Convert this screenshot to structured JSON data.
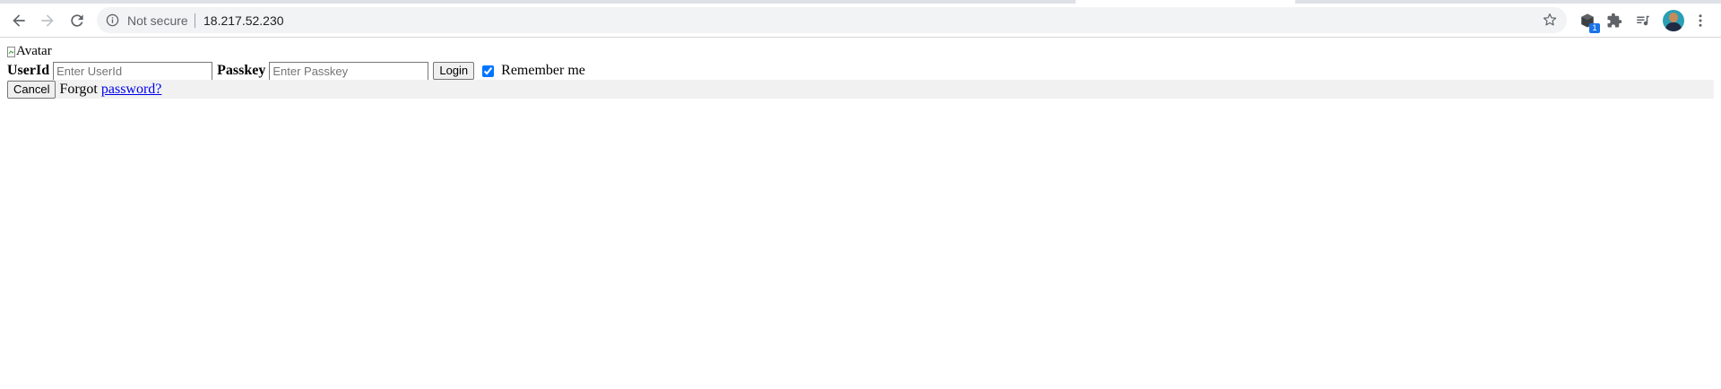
{
  "browser": {
    "security_label": "Not secure",
    "url": "18.217.52.230",
    "extension_badge": "1",
    "icons": {
      "back": "arrow-left-icon",
      "forward": "arrow-right-icon",
      "reload": "reload-icon",
      "info": "info-icon",
      "bookmark": "star-icon",
      "extension": "cube-extension-icon",
      "extensions_menu": "puzzle-icon",
      "media": "media-queue-icon",
      "menu": "kebab-menu-icon"
    }
  },
  "page": {
    "avatar_alt": "Avatar",
    "userid_label": "UserId",
    "userid_placeholder": "Enter UserId",
    "passkey_label": "Passkey",
    "passkey_placeholder": "Enter Passkey",
    "login_label": "Login",
    "remember_label": "Remember me",
    "remember_checked": true,
    "cancel_label": "Cancel",
    "forgot_text": "Forgot",
    "forgot_link": "password?"
  },
  "colors": {
    "link": "#0000ee",
    "cancel_bar_bg": "#f1f1f1",
    "checkbox_accent": "#0075ff"
  }
}
